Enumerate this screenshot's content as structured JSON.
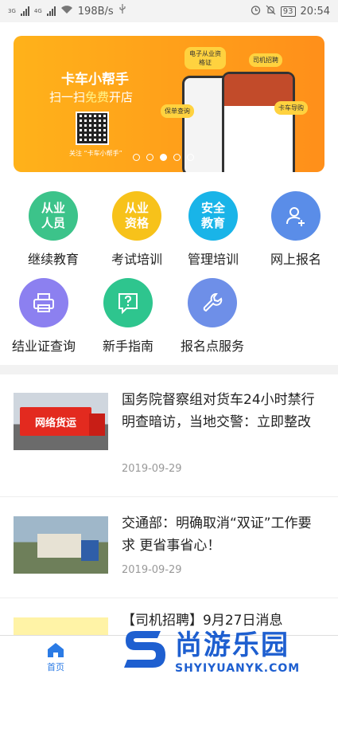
{
  "status_bar": {
    "network_left_1": "3G",
    "network_left_2": "4G",
    "speed": "198B/s",
    "battery": "93",
    "time": "20:54"
  },
  "banner": {
    "title": "卡车小帮手",
    "subtitle_prefix": "扫一扫",
    "subtitle_highlight": "免费",
    "subtitle_suffix": "开店",
    "qr_caption": "关注 “卡车小帮手”",
    "bubbles": [
      "电子从业资格证",
      "司机招聘",
      "保单查询",
      "卡车导购"
    ],
    "dots_count": 5,
    "active_dot": 2
  },
  "grid": [
    {
      "icon_text": "从业\n人员",
      "label": "继续教育",
      "color": "#3cc38a",
      "icon": "text"
    },
    {
      "icon_text": "从业\n资格",
      "label": "考试培训",
      "color": "#f7c21a",
      "icon": "text"
    },
    {
      "icon_text": "安全\n教育",
      "label": "管理培训",
      "color": "#19b4e8",
      "icon": "text"
    },
    {
      "icon_text": "",
      "label": "网上报名",
      "color": "#5a8de8",
      "icon": "add-user-icon"
    },
    {
      "icon_text": "",
      "label": "结业证查询",
      "color": "#8c80f0",
      "icon": "printer-icon"
    },
    {
      "icon_text": "",
      "label": "新手指南",
      "color": "#2ec58e",
      "icon": "help-icon"
    },
    {
      "icon_text": "",
      "label": "报名点服务",
      "color": "#6e8fe8",
      "icon": "wrench-icon"
    }
  ],
  "news": [
    {
      "title": "国务院督察组对货车24小时禁行明查暗访，当地交警：立即整改",
      "date": "2019-09-29",
      "img_text": "网络货运"
    },
    {
      "title": "交通部：明确取消“双证”工作要求 更省事省心！",
      "date": "2019-09-29",
      "img_text": ""
    },
    {
      "title": "【司机招聘】9月27日消息",
      "date": "",
      "img_text": ""
    }
  ],
  "tabbar": {
    "home_label": "首页"
  },
  "watermark": {
    "cn": "尚游乐园",
    "en": "SHYIYUANYK.COM"
  }
}
